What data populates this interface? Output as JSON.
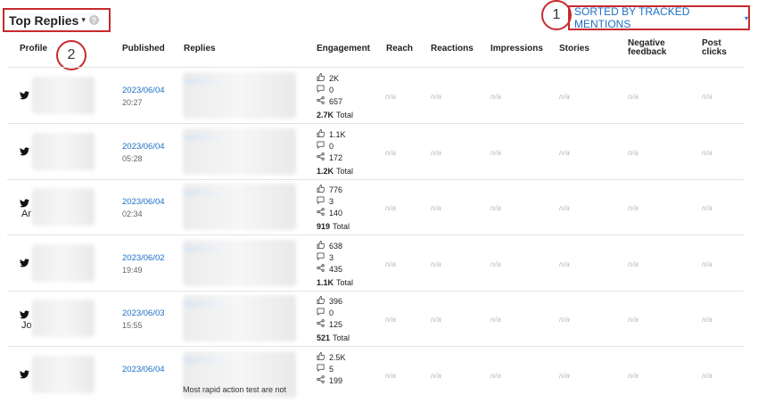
{
  "header": {
    "title": "Top Replies",
    "title_caret": "▾",
    "help_icon": "?",
    "sort_label": "SORTED BY TRACKED MENTIONS",
    "sort_caret": "▾"
  },
  "callouts": [
    "1",
    "2"
  ],
  "columns": {
    "profile": "Profile",
    "published": "Published",
    "replies": "Replies",
    "engagement": "Engagement",
    "reach": "Reach",
    "reactions": "Reactions",
    "impressions": "Impressions",
    "stories": "Stories",
    "negative_feedback_1": "Negative",
    "negative_feedback_2": "feedback",
    "post_clicks_1": "Post",
    "post_clicks_2": "clicks"
  },
  "icons": {
    "twitter": "twitter-icon",
    "like": "thumbs-up-icon",
    "comment": "comment-icon",
    "share": "share-icon"
  },
  "na_label": "n/a",
  "total_suffix": "Total",
  "rows": [
    {
      "name_fragment": "",
      "date": "2023/06/04",
      "time": "20:27",
      "likes": "2K",
      "comments": "0",
      "shares": "657",
      "total": "2.7K",
      "reply_text": ""
    },
    {
      "name_fragment": "",
      "date": "2023/06/04",
      "time": "05:28",
      "likes": "1.1K",
      "comments": "0",
      "shares": "172",
      "total": "1.2K",
      "reply_text": ""
    },
    {
      "name_fragment": "Ar",
      "date": "2023/06/04",
      "time": "02:34",
      "likes": "776",
      "comments": "3",
      "shares": "140",
      "total": "919",
      "reply_text": ""
    },
    {
      "name_fragment": "",
      "date": "2023/06/02",
      "time": "19:49",
      "likes": "638",
      "comments": "3",
      "shares": "435",
      "total": "1.1K",
      "reply_text": ""
    },
    {
      "name_fragment": "Jo",
      "date": "2023/06/03",
      "time": "15:55",
      "likes": "396",
      "comments": "0",
      "shares": "125",
      "total": "521",
      "reply_text": ""
    },
    {
      "name_fragment": "",
      "date": "2023/06/04",
      "time": "",
      "likes": "2.5K",
      "comments": "5",
      "shares": "199",
      "total": "",
      "reply_text": "Most rapid action test are not"
    }
  ],
  "colors": {
    "accent_red": "#c62a2f",
    "link_blue": "#1d6fc7",
    "na_gray": "#b9b9b9"
  }
}
